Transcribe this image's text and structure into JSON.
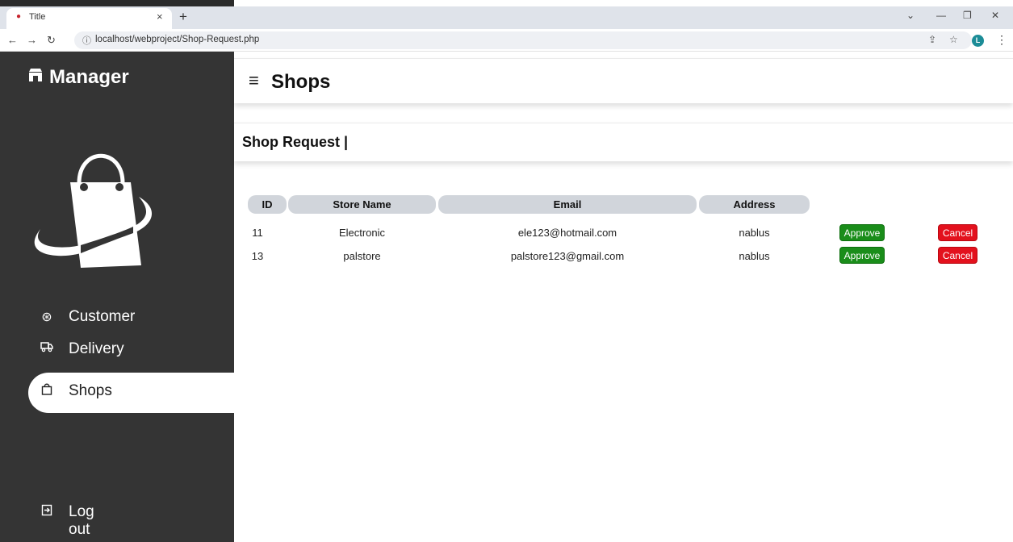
{
  "browser": {
    "tab_title": "Title",
    "url": "localhost/webproject/Shop-Request.php",
    "profile_initial": "L"
  },
  "sidebar": {
    "brand": "Manager",
    "items": [
      {
        "label": "Customer",
        "icon": "user-circle-icon",
        "active": false
      },
      {
        "label": "Delivery",
        "icon": "truck-icon",
        "active": false
      },
      {
        "label": "Shops",
        "icon": "shopping-bag-icon",
        "active": true
      }
    ],
    "logout": "Log out"
  },
  "header": {
    "title": "Shops"
  },
  "subheader": {
    "title": "Shop Request |"
  },
  "table": {
    "columns": [
      "ID",
      "Store Name",
      "Email",
      "Address"
    ],
    "rows": [
      {
        "id": "11",
        "store_name": "Electronic",
        "email": "ele123@hotmail.com",
        "address": "nablus",
        "approve": "Approve",
        "cancel": "Cancel"
      },
      {
        "id": "13",
        "store_name": "palstore",
        "email": "palstore123@gmail.com",
        "address": "nablus",
        "approve": "Approve",
        "cancel": "Cancel"
      }
    ]
  },
  "colors": {
    "sidebar_bg": "#343434",
    "approve": "#1a8d1a",
    "cancel": "#e3111d",
    "header_cell": "#d1d5db"
  }
}
